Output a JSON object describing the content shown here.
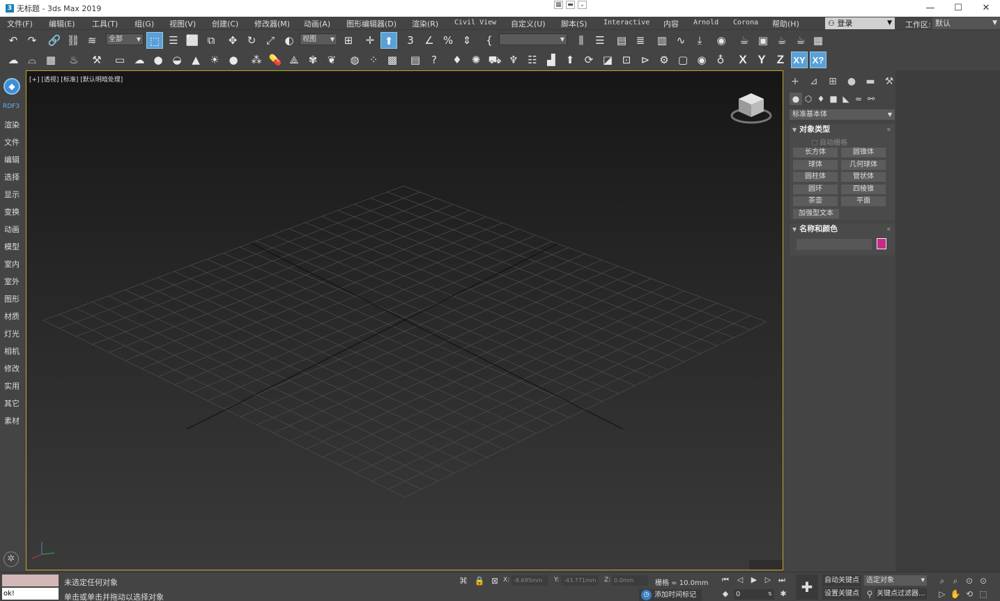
{
  "title_bar": {
    "app_title": "无标题 - 3ds Max 2019",
    "app_icon": "3",
    "min": "—",
    "max": "☐",
    "close": "✕"
  },
  "menus": [
    "文件(F)",
    "编辑(E)",
    "工具(T)",
    "组(G)",
    "视图(V)",
    "创建(C)",
    "修改器(M)",
    "动画(A)",
    "图形编辑器(D)",
    "渲染(R)",
    "Civil View",
    "自定义(U)",
    "脚本(S)",
    "Interactive",
    "内容",
    "Arnold",
    "Corona",
    "帮助(H)"
  ],
  "login": {
    "label": "登录",
    "icon": "user-icon"
  },
  "workspace": {
    "label": "工作区:",
    "value": "默认"
  },
  "toolbar": {
    "selection_filter": "全部",
    "ref_coord": "视图"
  },
  "axis_buttons": {
    "x": "X",
    "y": "Y",
    "z": "Z",
    "xy": "XY",
    "xy2": "X?"
  },
  "left_panel": {
    "brand": "RDF3",
    "items": [
      "渲染",
      "文件",
      "编辑",
      "选择",
      "显示",
      "变换",
      "动画",
      "模型",
      "室内",
      "室外",
      "图形",
      "材质",
      "灯光",
      "相机",
      "修改",
      "实用",
      "其它",
      "素材"
    ]
  },
  "viewport": {
    "label": "[+] [透视] [标准] [默认明暗处理]"
  },
  "command_panel": {
    "category": "标准基本体",
    "object_type": {
      "title": "对象类型",
      "autogrid": "自动栅格",
      "buttons": [
        "长方体",
        "圆锥体",
        "球体",
        "几何球体",
        "圆柱体",
        "管状体",
        "圆环",
        "四棱锥",
        "茶壶",
        "平面",
        "加强型文本"
      ]
    },
    "name_color": {
      "title": "名称和颜色",
      "swatch_color": "#c8288a"
    }
  },
  "status": {
    "maxscript_output": "ok!",
    "line1": "未选定任何对象",
    "line2": "单击或单击并拖动以选择对象",
    "x_label": "X:",
    "x_value": "-8.695mm",
    "y_label": "Y:",
    "y_value": "-43.771mm",
    "z_label": "Z:",
    "z_value": "0.0mm",
    "grid": "栅格 = 10.0mm",
    "add_time_tag": "添加时间标记",
    "frame": "0",
    "auto_key": "自动关键点",
    "selected_object": "选定对象",
    "set_key": "设置关键点",
    "key_filters": "关键点过滤器..."
  }
}
